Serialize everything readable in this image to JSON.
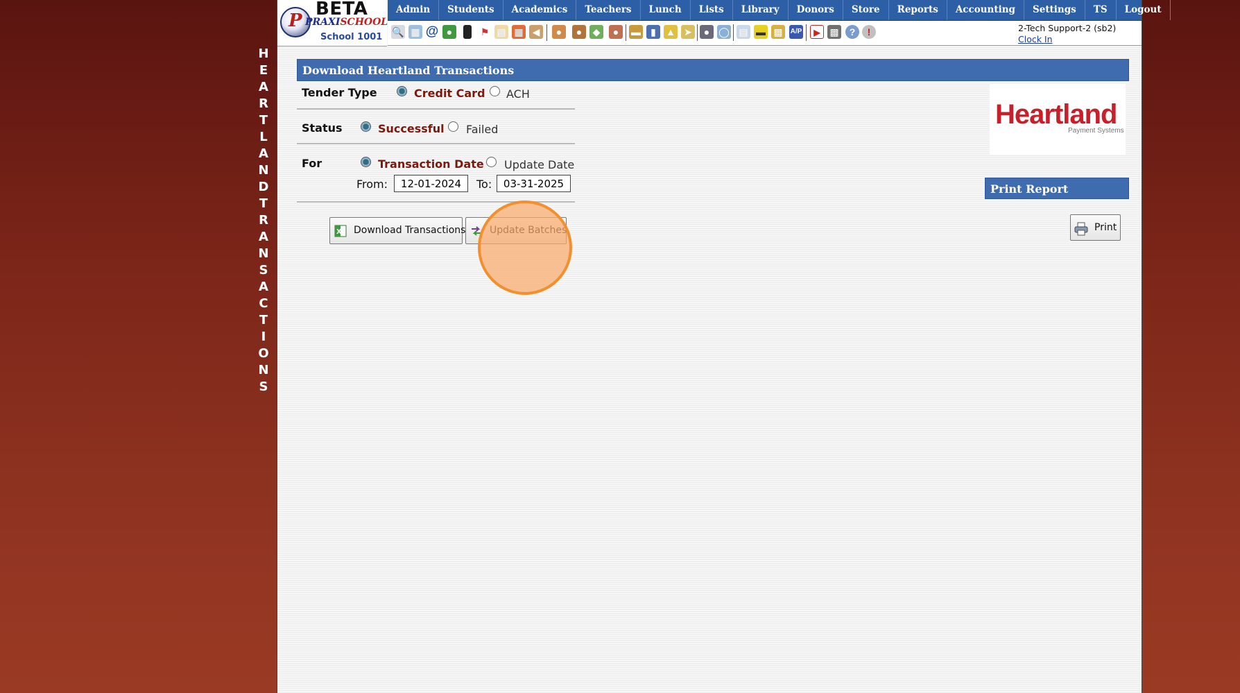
{
  "side_title": "HEARTLAND TRANSACTIONS",
  "header": {
    "beta_label": "BETA",
    "brand_praxi": "PRAXI",
    "brand_school": "SCHOOL",
    "school_name": "School 1001",
    "menu": [
      "Admin",
      "Students",
      "Academics",
      "Teachers",
      "Lunch",
      "Lists",
      "Library",
      "Donors",
      "Store",
      "Reports",
      "Accounting",
      "Settings",
      "TS",
      "Logout"
    ],
    "user": "2-Tech Support-2 (sb2)",
    "clock_in": "Clock In"
  },
  "toolbar_icons": [
    "search-icon",
    "calendar-grid-icon",
    "email-at-icon",
    "chat-icon",
    "mobile-phone-icon",
    "flag-icon",
    "newsletter-icon",
    "calendar-icon",
    "megaphone-icon",
    "add-student-icon",
    "student-icon",
    "payment-icon",
    "family-icon",
    "lunch-icon",
    "book-icon",
    "bell-icon",
    "forward-icon",
    "teacher-icon",
    "clock-icon",
    "report-icon",
    "money-icon",
    "printer-folder-icon",
    "ap-icon",
    "pdf-icon",
    "cash-register-icon",
    "help-icon",
    "alert-icon"
  ],
  "form": {
    "title": "Download Heartland Transactions",
    "tender_type": {
      "label": "Tender Type",
      "option1": "Credit Card",
      "option2": "ACH",
      "selected": "Credit Card"
    },
    "status": {
      "label": "Status",
      "option1": "Successful",
      "option2": "Failed",
      "selected": "Successful"
    },
    "for": {
      "label": "For",
      "option1": "Transaction Date",
      "option2": "Update Date",
      "selected": "Transaction Date"
    },
    "from_label": "From:",
    "from_value": "12-01-2024",
    "to_label": "To:",
    "to_value": "03-31-2025",
    "download_button": "Download Transactions",
    "update_button": "Update Batches"
  },
  "print_panel": {
    "title": "Print Report",
    "print_button": "Print"
  },
  "logo": {
    "word": "Heartland",
    "sub": "Payment Systems"
  },
  "colors": {
    "menu_bar": "#2d5fa6",
    "section_header": "#3f6cae",
    "selected_option": "#7a1a0e",
    "highlight": "#f2902f",
    "heartland_red": "#c8202a"
  }
}
